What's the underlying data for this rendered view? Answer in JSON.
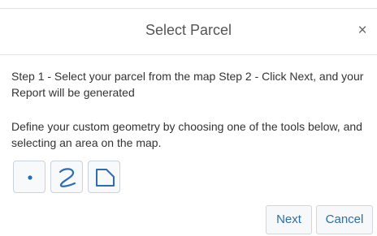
{
  "dialog": {
    "title": "Select Parcel",
    "close_label": "×"
  },
  "body": {
    "steps_text": "Step 1 - Select your parcel from the map  Step 2 - Click Next, and your Report will be generated",
    "define_text": "Define your custom geometry by choosing one of the tools below, and selecting an area on the map."
  },
  "tools": [
    {
      "name": "point",
      "icon": "point-icon"
    },
    {
      "name": "freehand",
      "icon": "freehand-icon"
    },
    {
      "name": "polygon",
      "icon": "polygon-icon"
    }
  ],
  "footer": {
    "next_label": "Next",
    "cancel_label": "Cancel"
  },
  "colors": {
    "icon_blue": "#2a6db5",
    "button_text": "#2d6ea9",
    "border": "#c9d2dc"
  }
}
